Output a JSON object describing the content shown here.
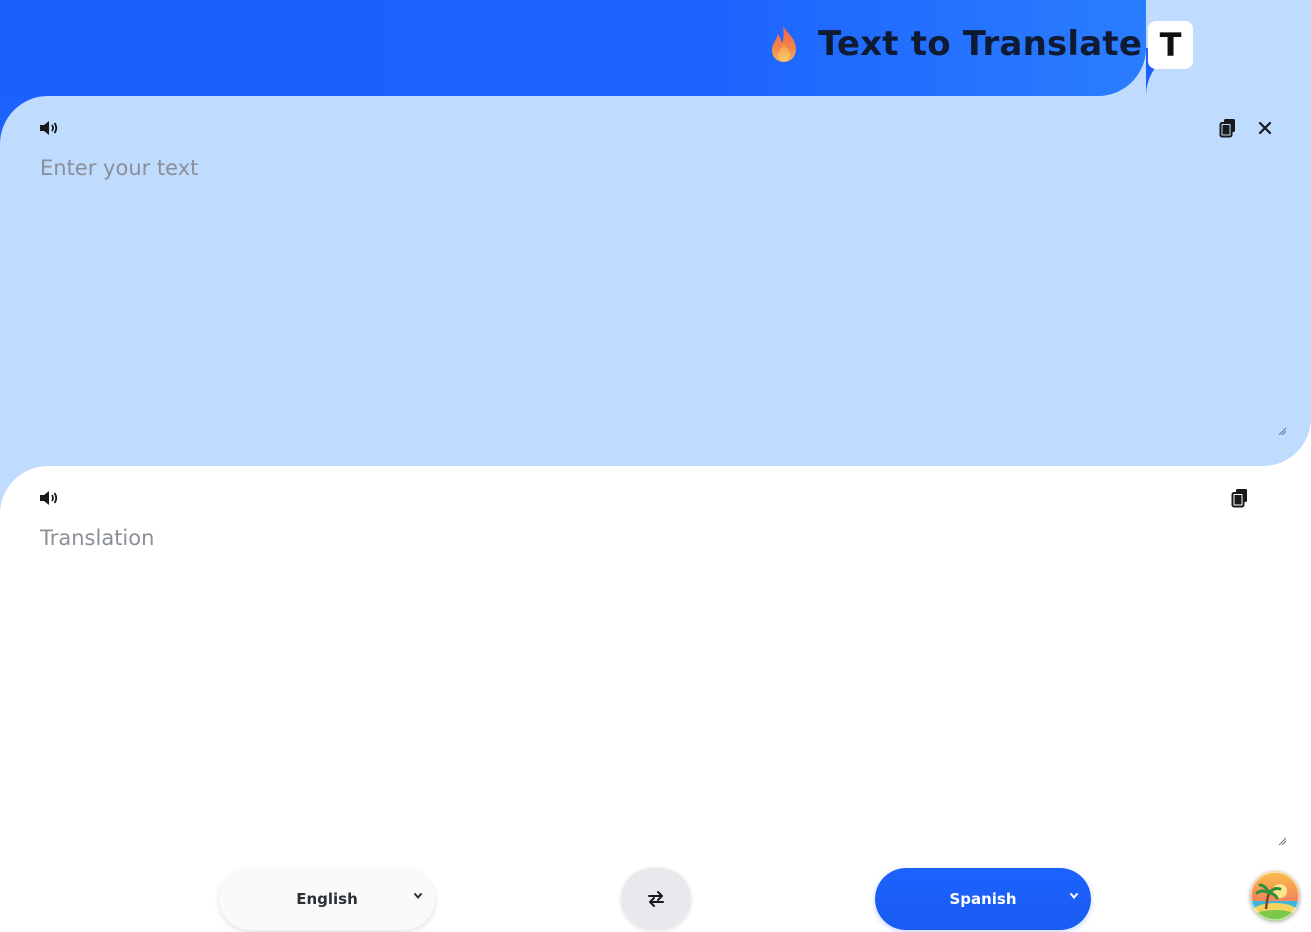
{
  "header": {
    "title": "Text to Translate",
    "flame_icon": "flame-icon",
    "theme_button_label": "T"
  },
  "source": {
    "placeholder": "Enter your text",
    "value": "",
    "icons": [
      "speaker-icon",
      "copy-icon",
      "close-icon"
    ]
  },
  "target": {
    "placeholder": "Translation",
    "value": "",
    "icons": [
      "speaker-icon",
      "copy-icon"
    ]
  },
  "languages": {
    "from": "English",
    "to": "Spanish",
    "swap_icon": "swap-arrows-icon"
  },
  "colors": {
    "brand_blue": "#1c62fe",
    "source_panel_bg": "#bfdbfe",
    "target_panel_bg": "#ffffff",
    "title_text": "#0f1a33"
  },
  "avatar": {
    "icon": "beach-island-avatar"
  }
}
